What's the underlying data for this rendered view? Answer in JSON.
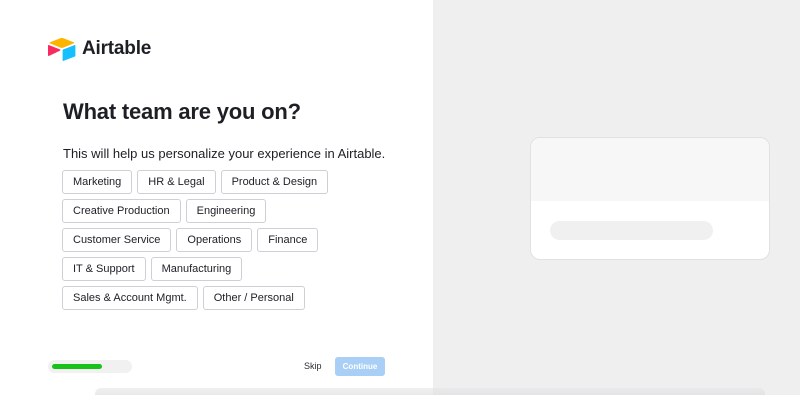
{
  "brand": {
    "name": "Airtable"
  },
  "page": {
    "heading": "What team are you on?",
    "subtitle": "This will help us personalize your experience in Airtable."
  },
  "options": [
    [
      "Marketing",
      "HR & Legal",
      "Product & Design"
    ],
    [
      "Creative Production",
      "Engineering"
    ],
    [
      "Customer Service",
      "Operations",
      "Finance"
    ],
    [
      "IT & Support",
      "Manufacturing"
    ],
    [
      "Sales & Account Mgmt.",
      "Other / Personal"
    ]
  ],
  "progress": {
    "fraction": 0.66
  },
  "footer": {
    "skip_label": "Skip",
    "continue_label": "Continue"
  },
  "colors": {
    "progress_fill": "#18c21a",
    "continue_disabled": "#a9cff6"
  }
}
